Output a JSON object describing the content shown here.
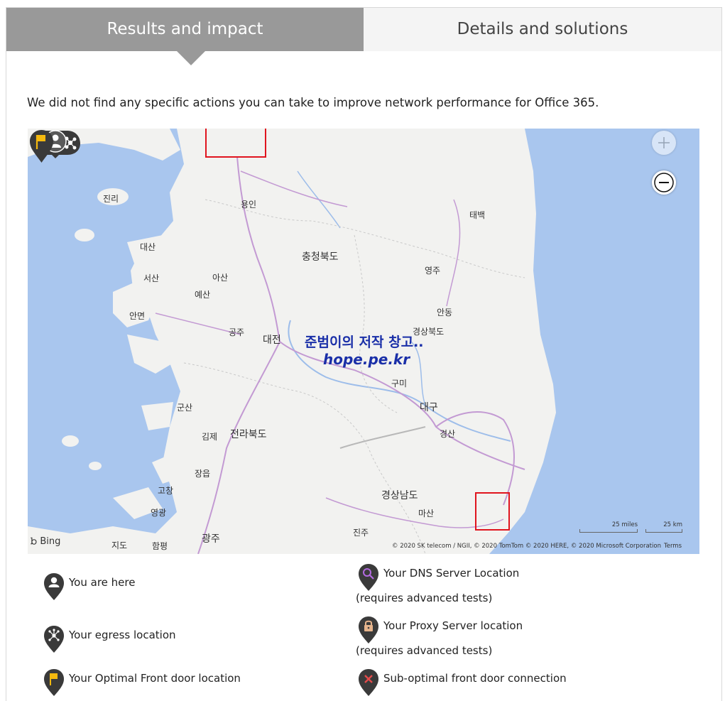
{
  "tabs": [
    {
      "label": "Results and impact",
      "active": true
    },
    {
      "label": "Details and solutions",
      "active": false
    }
  ],
  "message": "We did not find any specific actions you can take to improve network performance for Office 365.",
  "map": {
    "places": [
      "진리",
      "용인",
      "대산",
      "서산",
      "아산",
      "예산",
      "안면",
      "공주",
      "대전",
      "충청북도",
      "태백",
      "영주",
      "안동",
      "경상북도",
      "구미",
      "대구",
      "경산",
      "군산",
      "김제",
      "전라북도",
      "장읍",
      "고창",
      "영광",
      "광주",
      "함평",
      "지도",
      "경상남도",
      "마산",
      "진주"
    ],
    "watermark": [
      "준범이의 저작 창고..",
      "hope.pe.kr"
    ],
    "brand": "Bing",
    "attribution": "© 2020 SK telecom / NGII, © 2020 TomTom © 2020 HERE, © 2020 Microsoft Corporation",
    "terms": "Terms",
    "scale": [
      "25 miles",
      "25 km"
    ],
    "zoom_icons": [
      "plus-icon",
      "minus-icon"
    ],
    "colors": {
      "water": "#a9c6ee",
      "land": "#f2f2f0",
      "highlight": "#e0141e",
      "marker": "#3a3a3a",
      "flag": "#f5b90f"
    }
  },
  "legend": {
    "you_are_here": "You are here",
    "egress": "Your egress location",
    "optimal_front_door": "Your Optimal Front door location",
    "dns_server": "Your DNS Server Location",
    "dns_note": "(requires advanced tests)",
    "proxy_server": "Your Proxy Server location",
    "proxy_note": "(requires advanced tests)",
    "suboptimal": "Sub-optimal front door connection"
  }
}
